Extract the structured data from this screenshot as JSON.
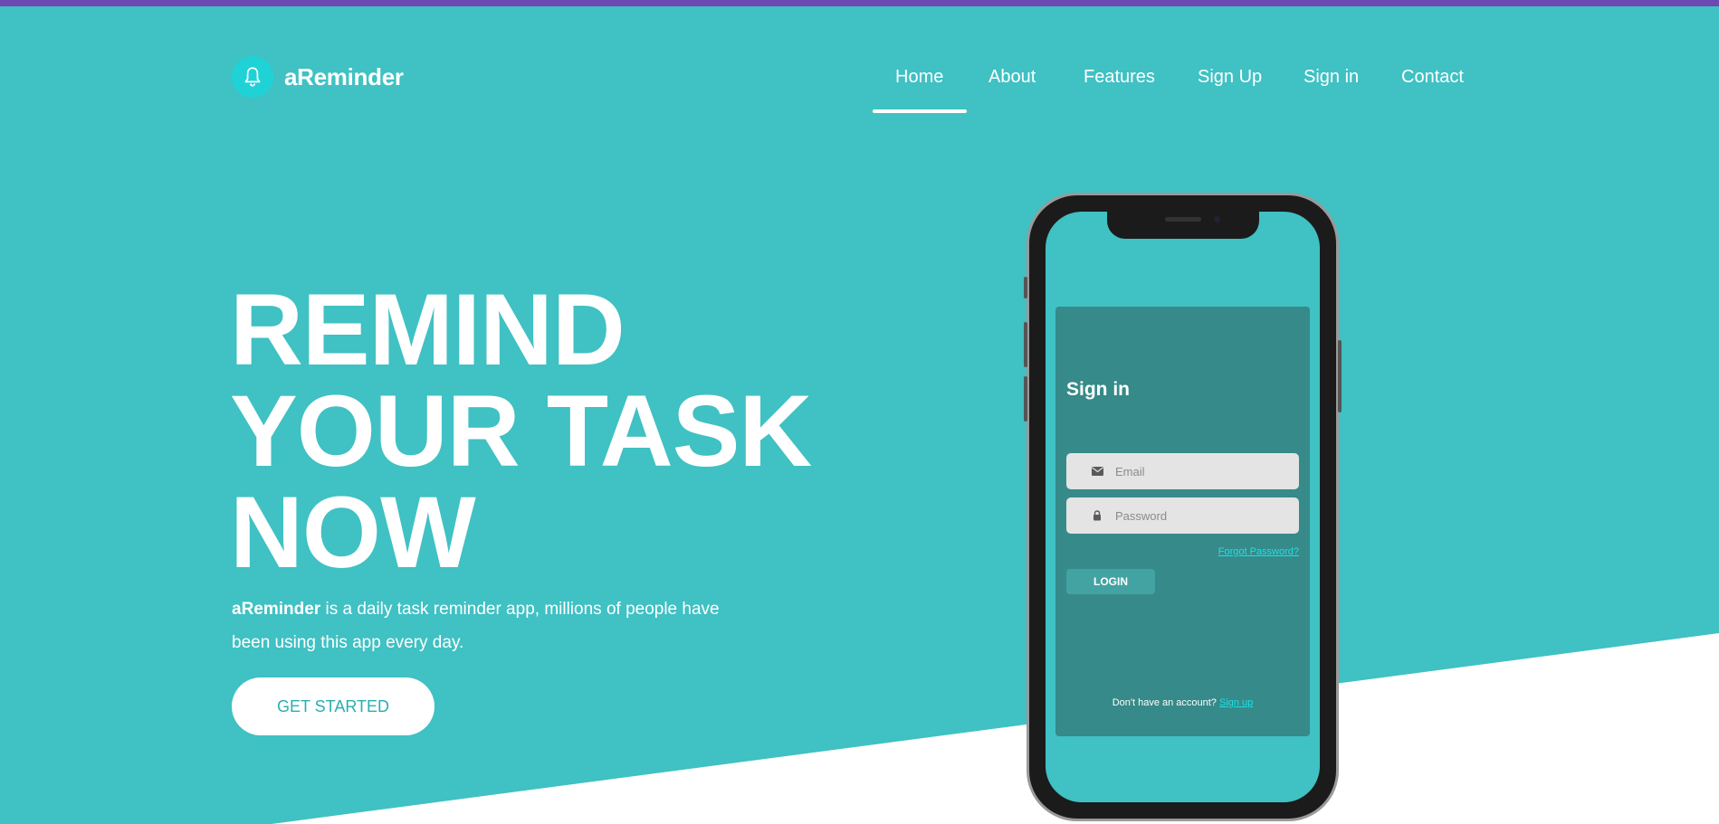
{
  "brand": {
    "name": "aReminder"
  },
  "nav": {
    "items": [
      {
        "label": "Home",
        "active": true
      },
      {
        "label": "About"
      },
      {
        "label": "Features"
      },
      {
        "label": "Sign Up"
      },
      {
        "label": "Sign in"
      },
      {
        "label": "Contact"
      }
    ]
  },
  "hero": {
    "headline": [
      "REMIND",
      "YOUR TASK",
      "NOW"
    ],
    "desc_brand": "aReminder",
    "desc_text": " is a daily task reminder app, millions of people have been using this app every day.",
    "cta_label": "GET STARTED"
  },
  "phone": {
    "signin_title": "Sign in",
    "email_placeholder": "Email",
    "password_placeholder": "Password",
    "forgot_label": "Forgot Password?",
    "login_label": "LOGIN",
    "no_account_text": "Don't have an account? ",
    "signup_link": "Sign up"
  },
  "colors": {
    "topbar": "#6d49b3",
    "hero_bg": "#40c1c3",
    "card_bg": "#368a89",
    "accent_link": "#1de0e8",
    "cta_text": "#2aaeb2"
  },
  "icons": {
    "brand": "bell-icon",
    "email": "envelope-icon",
    "password": "lock-icon"
  }
}
